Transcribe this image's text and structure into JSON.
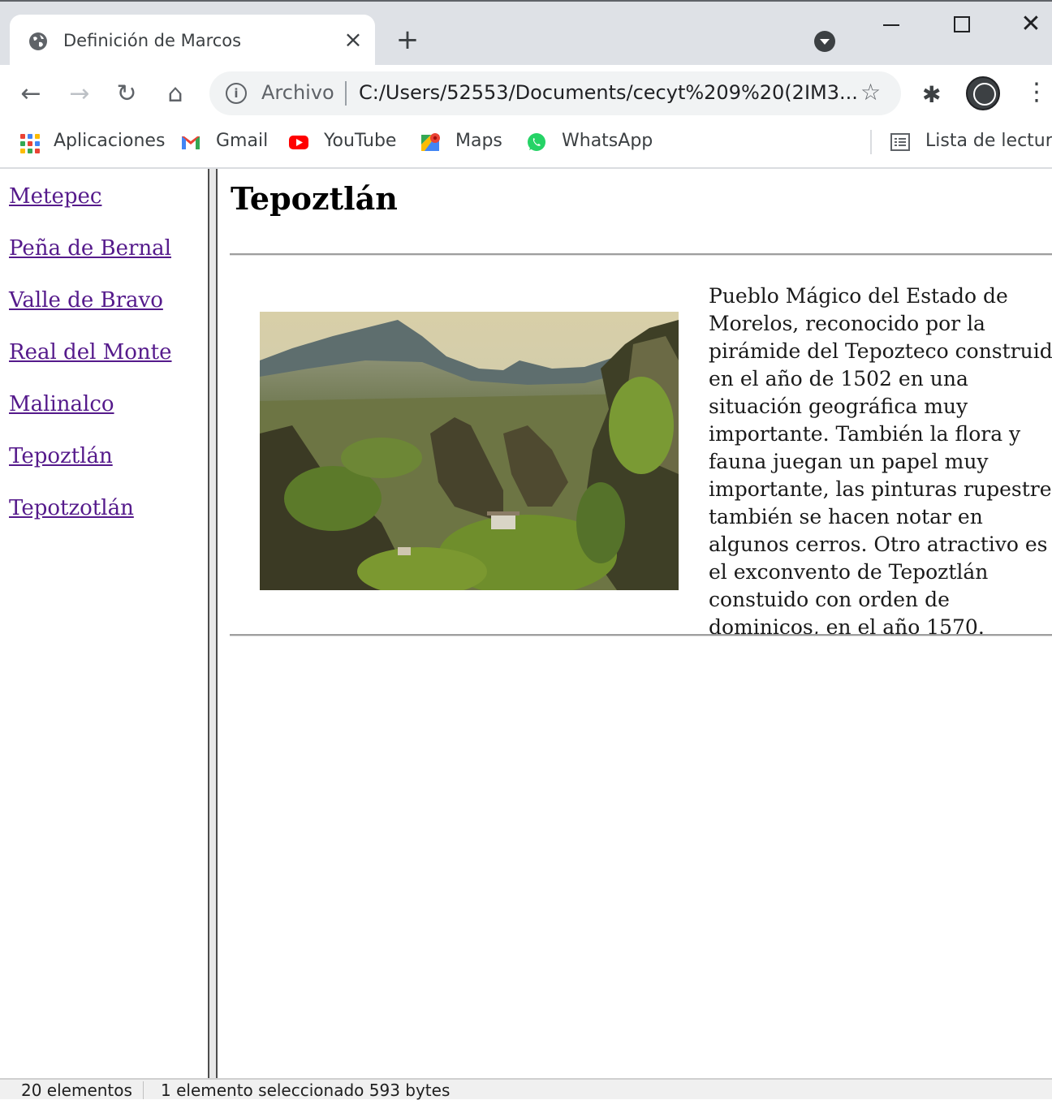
{
  "browser": {
    "tab": {
      "title": "Definición de Marcos",
      "close_glyph": "×",
      "favicon": "globe-icon"
    },
    "new_tab_glyph": "+",
    "window_controls": {
      "close_glyph": "✕"
    },
    "address_bar": {
      "scheme_label": "Archivo",
      "url": "C:/Users/52553/Documents/cecyt%209%20(2IM3...",
      "info_glyph": "i"
    },
    "nav_glyphs": {
      "back": "←",
      "forward": "→",
      "reload": "↻",
      "home": "⌂",
      "star": "☆",
      "extensions": "✱",
      "menu": "⋮"
    },
    "bookmarks": [
      {
        "label": "Aplicaciones",
        "icon": "apps-grid-icon"
      },
      {
        "label": "Gmail",
        "icon": "gmail-icon"
      },
      {
        "label": "YouTube",
        "icon": "youtube-icon"
      },
      {
        "label": "Maps",
        "icon": "maps-icon"
      },
      {
        "label": "WhatsApp",
        "icon": "whatsapp-icon"
      }
    ],
    "reading_list": {
      "label": "Lista de lectura",
      "icon": "reading-list-icon"
    }
  },
  "nav_frame": {
    "links": [
      "Metepec",
      "Peña de Bernal",
      "Valle de Bravo",
      "Real del Monte",
      "Malinalco",
      "Tepoztlán",
      "Tepotzotlán"
    ]
  },
  "content": {
    "title": "Tepoztlán",
    "description": "Pueblo Mágico del Estado de Morelos, reconocido por la pirámide del Tepozteco construida en el año de 1502 en una situación geográfica muy importante. También la flora y fauna juegan un papel muy importante, las pinturas rupestres también se hacen notar en algunos cerros. Otro atractivo es el exconvento de Tepoztlán constuido con orden de dominicos, en el año 1570."
  },
  "statusbar": {
    "item_count": "20 elementos",
    "selection": "1 elemento seleccionado  593 bytes"
  },
  "colors": {
    "link_visited": "#551a8b",
    "chrome_bg": "#dee1e6",
    "omnibox_bg": "#f1f3f4"
  }
}
